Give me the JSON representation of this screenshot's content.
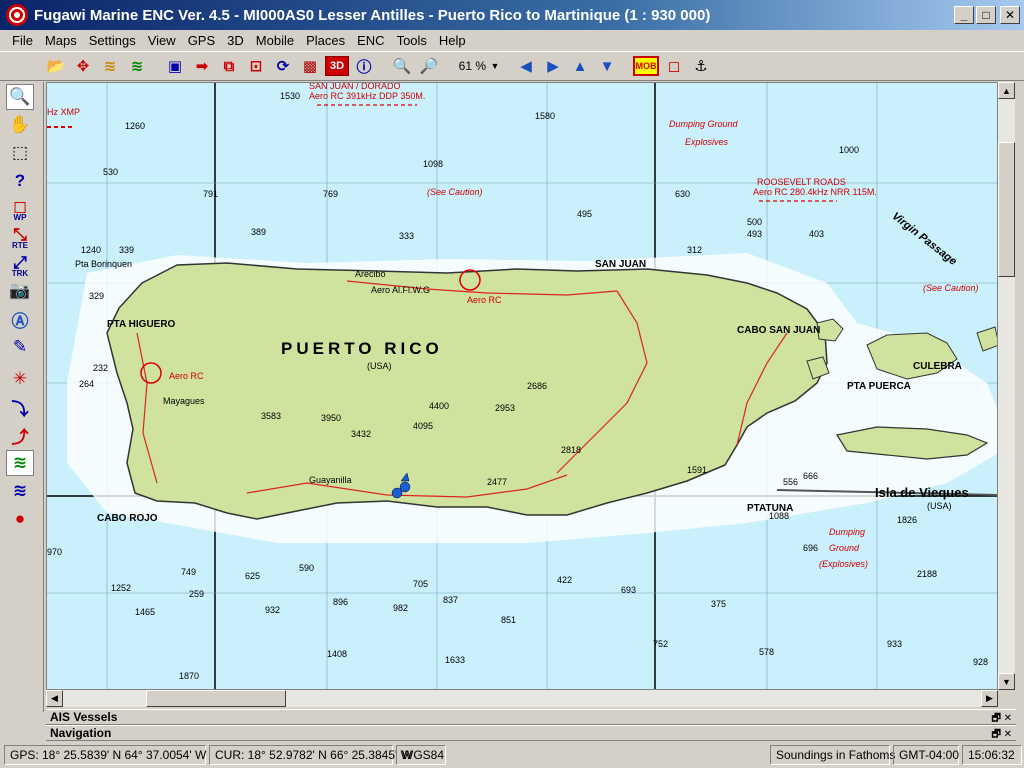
{
  "window": {
    "title": "Fugawi Marine ENC Ver. 4.5 - MI000AS0  Lesser Antilles - Puerto Rico to Martinique  (1 : 930 000)",
    "minimize_label": "_",
    "maximize_label": "□",
    "close_label": "✕"
  },
  "menu": [
    "File",
    "Maps",
    "Settings",
    "View",
    "GPS",
    "3D",
    "Mobile",
    "Places",
    "ENC",
    "Tools",
    "Help"
  ],
  "toolbar": {
    "zoom_level": "61 %",
    "mob_label": "MOB",
    "three_d_label": "3D"
  },
  "left_tools": {
    "wp_label": "WP",
    "rte_label": "RTE",
    "trk_label": "TRK"
  },
  "map": {
    "island_label": "PUERTO RICO",
    "usa_label": "(USA)",
    "san_juan": "SAN JUAN",
    "cabo_san_juan": "CABO SAN JUAN",
    "culebra": "CULEBRA",
    "pta_puerca": "PTA PUERCA",
    "vieques": "Isla de Vieques",
    "vieques_usa": "(USA)",
    "virgin_passage": "Virgin Passage",
    "cabo_rojo": "CABO ROJO",
    "pta_higuero": "PTA HIGUERO",
    "pta_tuna": "PTATUNA",
    "arecibo": "Arecibo",
    "mayaguez": "Mayagues",
    "guayanilla": "Guayanilla",
    "pta_borinquen": "Pta Borinquen",
    "san_juan_dorado": "SAN JUAN / DORADO",
    "aero_rc_391": "Aero RC  391kHz DDP 350M.",
    "roosevelt": "ROOSEVELT ROADS",
    "roosevelt_aero": "Aero RC 280.4kHz NRR 115M.",
    "dumping1": "Dumping   Ground",
    "explosives1": "Explosives",
    "dumping2": "Dumping",
    "ground2": "Ground",
    "explosives2": "(Explosives)",
    "see_caution1": "(See Caution)",
    "see_caution2": "(See Caution)",
    "aero_rc_left": "Aero RC",
    "aero_rc_mid": "Aero RC",
    "aero_alfl": "Aero Al.Fl.W.G",
    "hz_xmp": "Hz XMP",
    "soundings": [
      "1530",
      "1580",
      "1260",
      "1000",
      "1098",
      "530",
      "791",
      "769",
      "495",
      "630",
      "500",
      "493",
      "403",
      "389",
      "333",
      "312",
      "1240",
      "339",
      "329",
      "232",
      "264",
      "4400",
      "3583",
      "3950",
      "3432",
      "4095",
      "2953",
      "2686",
      "2818",
      "2477",
      "1591",
      "1088",
      "666",
      "556",
      "1826",
      "2188",
      "696",
      "970",
      "749",
      "1252",
      "259",
      "625",
      "590",
      "896",
      "932",
      "982",
      "837",
      "851",
      "752",
      "1465",
      "1408",
      "1633",
      "578",
      "933",
      "928",
      "1870",
      "705",
      "422",
      "693",
      "375"
    ]
  },
  "panels": {
    "ais": "AIS Vessels",
    "navigation": "Navigation",
    "panel_btns": "🗗 ✕"
  },
  "status": {
    "gps": "GPS: 18° 25.5839' N 64° 37.0054' W",
    "cur": "CUR: 18° 52.9782' N 66° 25.3845' W",
    "datum": "WGS84",
    "soundings_unit": "Soundings in Fathoms",
    "timezone": "GMT-04:00",
    "time": "15:06:32"
  }
}
